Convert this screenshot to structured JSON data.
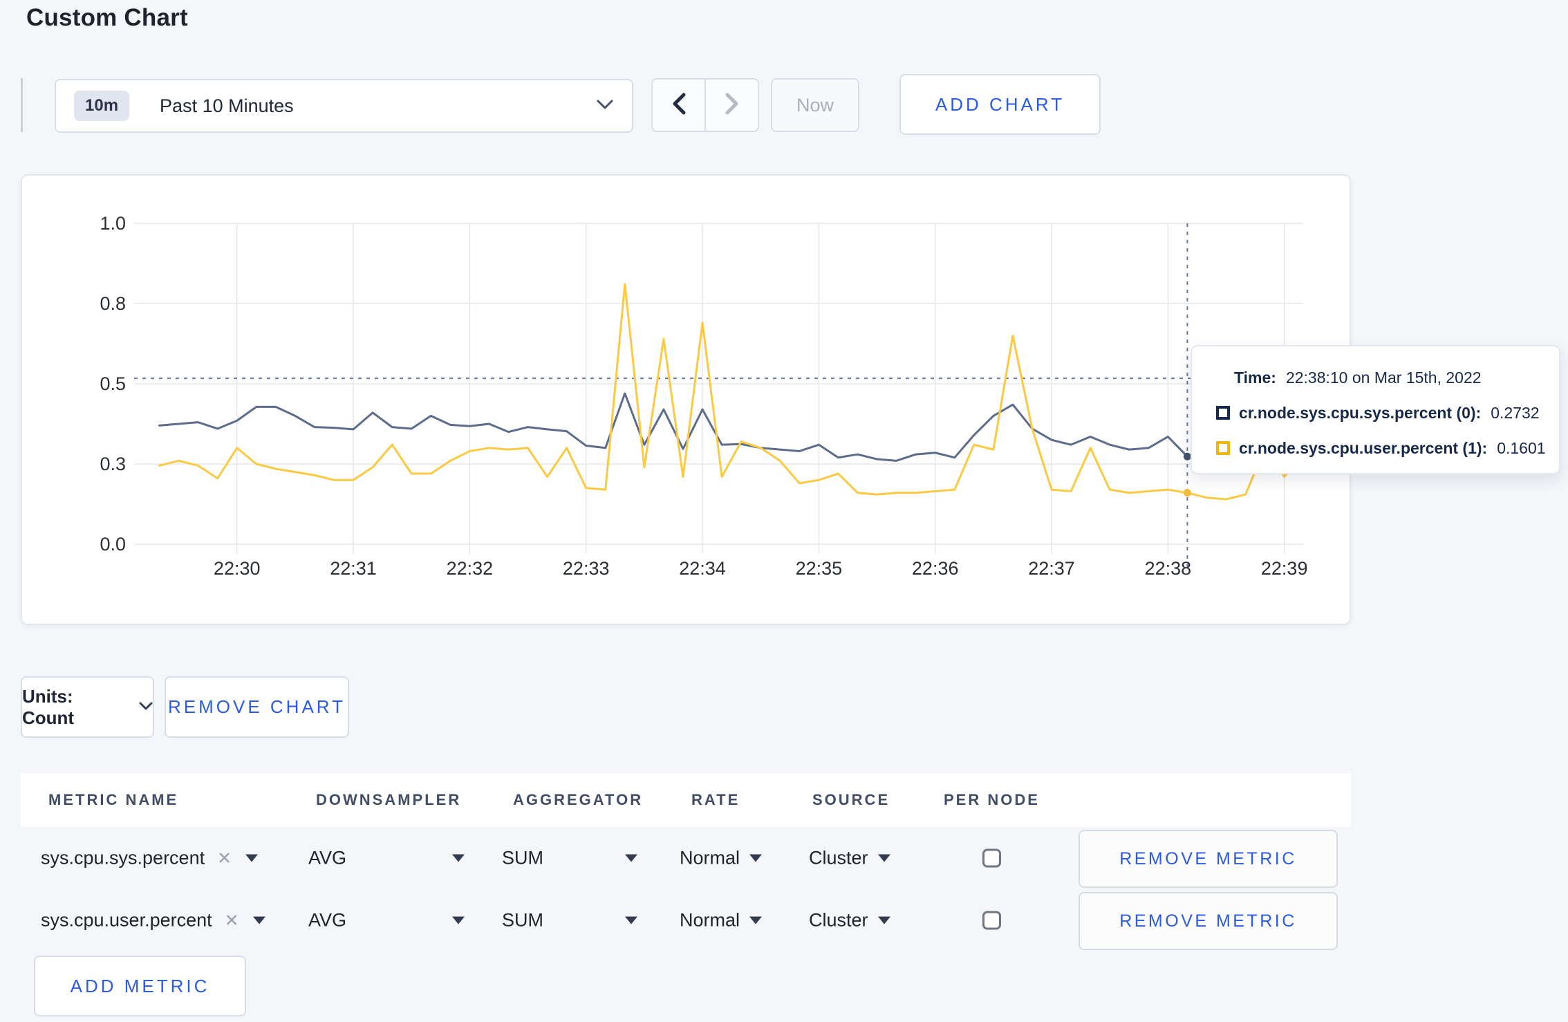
{
  "page": {
    "title": "Custom Chart",
    "background": "#f4f6fa"
  },
  "toolbar": {
    "time_badge": "10m",
    "time_label": "Past 10 Minutes",
    "prev_icon": "chevron-left",
    "next_icon": "chevron-right",
    "now_label": "Now",
    "add_chart_label": "ADD CHART"
  },
  "colors": {
    "accent_blue": "#2b5be2",
    "series_sys_line": "#5c6c8a",
    "series_sys_swatch": "#17294d",
    "series_user_line": "#fbc942",
    "series_user_swatch": "#f3b70b",
    "crosshair": "#64789e",
    "gridline": "#e6e7ea"
  },
  "chart_data": {
    "type": "line",
    "title": "",
    "xlabel": "",
    "ylabel": "",
    "ylim": [
      0,
      1
    ],
    "grid": true,
    "legend_position": "tooltip",
    "x_times": [
      "22:29:20",
      "22:29:30",
      "22:29:40",
      "22:29:50",
      "22:30:00",
      "22:30:10",
      "22:30:20",
      "22:30:30",
      "22:30:40",
      "22:30:50",
      "22:31:00",
      "22:31:10",
      "22:31:20",
      "22:31:30",
      "22:31:40",
      "22:31:50",
      "22:32:00",
      "22:32:10",
      "22:32:20",
      "22:32:30",
      "22:32:40",
      "22:32:50",
      "22:33:00",
      "22:33:10",
      "22:33:20",
      "22:33:30",
      "22:33:40",
      "22:33:50",
      "22:34:00",
      "22:34:10",
      "22:34:20",
      "22:34:30",
      "22:34:40",
      "22:34:50",
      "22:35:00",
      "22:35:10",
      "22:35:20",
      "22:35:30",
      "22:35:40",
      "22:35:50",
      "22:36:00",
      "22:36:10",
      "22:36:20",
      "22:36:30",
      "22:36:40",
      "22:36:50",
      "22:37:00",
      "22:37:10",
      "22:37:20",
      "22:37:30",
      "22:37:40",
      "22:37:50",
      "22:38:00",
      "22:38:10",
      "22:38:20",
      "22:38:30",
      "22:38:40",
      "22:38:50",
      "22:39:00",
      "22:39:10"
    ],
    "series": [
      {
        "name": "cr.node.sys.cpu.sys.percent",
        "node": "(0)",
        "color": "#5c6c8a",
        "dot_color": "#44536f",
        "values": [
          0.37,
          0.375,
          0.38,
          0.36,
          0.385,
          0.428,
          0.428,
          0.4,
          0.365,
          0.363,
          0.358,
          0.41,
          0.365,
          0.36,
          0.4,
          0.372,
          0.368,
          0.375,
          0.35,
          0.365,
          0.358,
          0.352,
          0.307,
          0.3,
          0.47,
          0.31,
          0.42,
          0.297,
          0.42,
          0.31,
          0.312,
          0.3,
          0.295,
          0.29,
          0.31,
          0.27,
          0.28,
          0.265,
          0.26,
          0.28,
          0.285,
          0.27,
          0.34,
          0.4,
          0.435,
          0.36,
          0.325,
          0.31,
          0.335,
          0.31,
          0.295,
          0.3,
          0.335,
          0.2732,
          0.3,
          0.295,
          0.29,
          0.3,
          0.31,
          0.305
        ]
      },
      {
        "name": "cr.node.sys.cpu.user.percent",
        "node": "(1)",
        "color": "#fbc942",
        "dot_color": "#f2b93a",
        "values": [
          0.245,
          0.26,
          0.245,
          0.205,
          0.3,
          0.25,
          0.235,
          0.225,
          0.215,
          0.2,
          0.2,
          0.24,
          0.31,
          0.22,
          0.22,
          0.26,
          0.29,
          0.3,
          0.295,
          0.3,
          0.21,
          0.3,
          0.175,
          0.17,
          0.81,
          0.24,
          0.64,
          0.21,
          0.69,
          0.21,
          0.32,
          0.3,
          0.26,
          0.19,
          0.2,
          0.22,
          0.16,
          0.155,
          0.16,
          0.16,
          0.165,
          0.17,
          0.31,
          0.295,
          0.65,
          0.36,
          0.17,
          0.165,
          0.3,
          0.17,
          0.16,
          0.165,
          0.17,
          0.1601,
          0.145,
          0.14,
          0.155,
          0.3,
          0.21,
          0.285
        ]
      }
    ],
    "yticks": [
      {
        "pos": 0.0,
        "label": "0.0"
      },
      {
        "pos": 0.25,
        "label": "0.3"
      },
      {
        "pos": 0.5,
        "label": "0.5"
      },
      {
        "pos": 0.75,
        "label": "0.8"
      },
      {
        "pos": 1.0,
        "label": "1.0"
      }
    ],
    "xticks": [
      {
        "index": 4,
        "label": "22:30"
      },
      {
        "index": 10,
        "label": "22:31"
      },
      {
        "index": 16,
        "label": "22:32"
      },
      {
        "index": 22,
        "label": "22:33"
      },
      {
        "index": 28,
        "label": "22:34"
      },
      {
        "index": 34,
        "label": "22:35"
      },
      {
        "index": 40,
        "label": "22:36"
      },
      {
        "index": 46,
        "label": "22:37"
      },
      {
        "index": 52,
        "label": "22:38"
      },
      {
        "index": 58,
        "label": "22:39"
      }
    ],
    "crosshair": {
      "index": 53,
      "h_pos": 0.517,
      "sys_value": 0.2732,
      "user_value": 0.1601
    }
  },
  "chart": {
    "tooltip": {
      "time_label": "Time:",
      "time_value": "22:38:10 on Mar 15th, 2022",
      "rows": [
        {
          "label": "cr.node.sys.cpu.sys.percent (0):",
          "value": "0.2732",
          "swatch": "#17294d"
        },
        {
          "label": "cr.node.sys.cpu.user.percent (1):",
          "value": "0.1601",
          "swatch": "#f3b70b"
        }
      ]
    }
  },
  "units_bar": {
    "units_label": "Units: Count",
    "remove_chart_label": "REMOVE CHART"
  },
  "metrics_table": {
    "columns": [
      "METRIC NAME",
      "DOWNSAMPLER",
      "AGGREGATOR",
      "RATE",
      "SOURCE",
      "PER NODE"
    ],
    "rows": [
      {
        "metric": "sys.cpu.sys.percent",
        "downsampler": "AVG",
        "aggregator": "SUM",
        "rate": "Normal",
        "source": "Cluster",
        "per_node": false,
        "remove_label": "REMOVE METRIC"
      },
      {
        "metric": "sys.cpu.user.percent",
        "downsampler": "AVG",
        "aggregator": "SUM",
        "rate": "Normal",
        "source": "Cluster",
        "per_node": false,
        "remove_label": "REMOVE METRIC"
      }
    ],
    "add_metric_label": "ADD METRIC"
  }
}
